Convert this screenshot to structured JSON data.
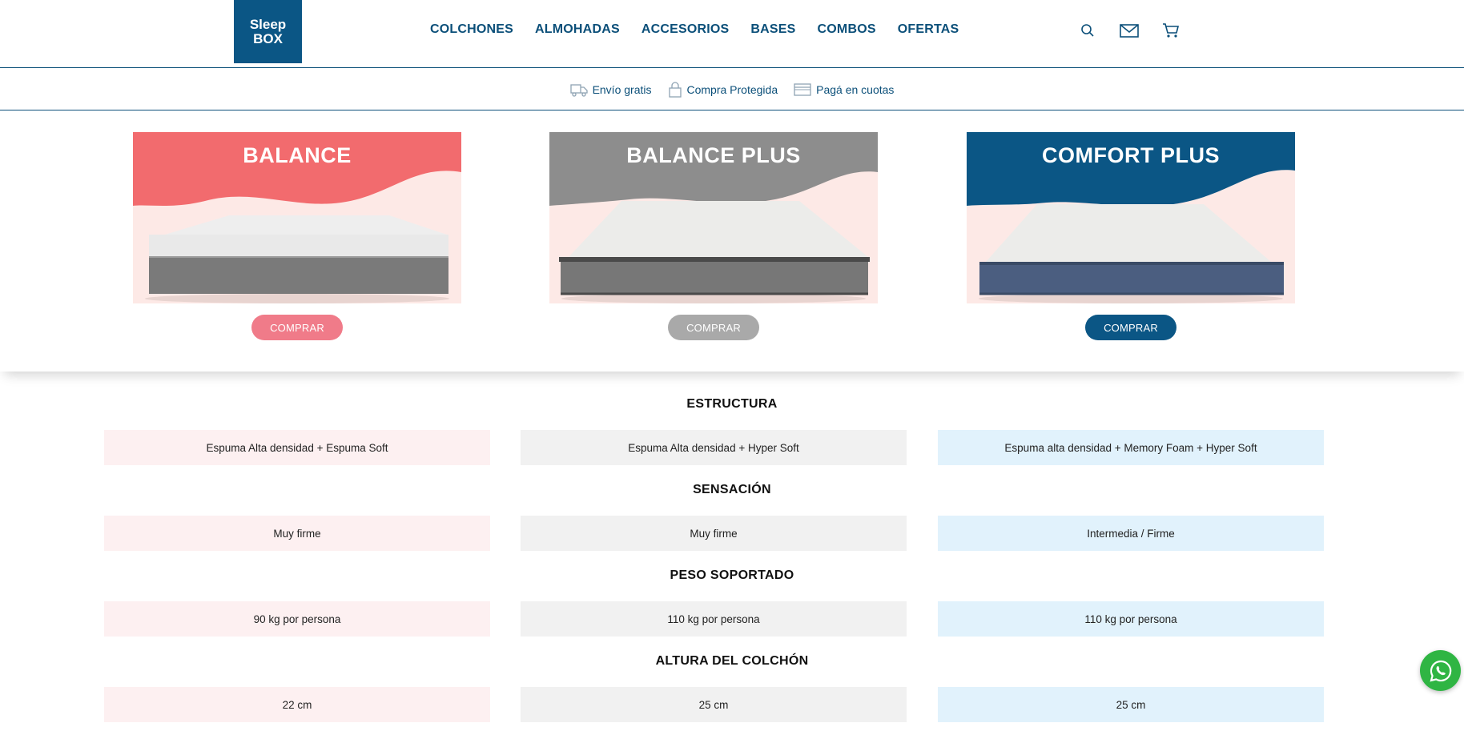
{
  "brand": {
    "line1": "Sleep",
    "line2": "BOX",
    "color": "#0b5685"
  },
  "nav": [
    "COLCHONES",
    "ALMOHADAS",
    "ACCESORIOS",
    "BASES",
    "COMBOS",
    "OFERTAS"
  ],
  "header_icons": [
    "search-icon",
    "mail-icon",
    "cart-icon"
  ],
  "benefits": [
    {
      "icon": "truck-icon",
      "label": "Envío gratis"
    },
    {
      "icon": "lock-icon",
      "label": "Compra Protegida"
    },
    {
      "icon": "card-icon",
      "label": "Pagá en cuotas"
    }
  ],
  "products": [
    {
      "name": "BALANCE",
      "button": "COMPRAR",
      "accent": "#f26b6e",
      "button_color": "#f07b89"
    },
    {
      "name": "BALANCE PLUS",
      "button": "COMPRAR",
      "accent": "#8d8d8d",
      "button_color": "#a9a9a9"
    },
    {
      "name": "COMFORT PLUS",
      "button": "COMPRAR",
      "accent": "#0b5685",
      "button_color": "#0b5685"
    }
  ],
  "specs": [
    {
      "title": "ESTRUCTURA",
      "values": [
        "Espuma Alta densidad + Espuma Soft",
        "Espuma Alta densidad + Hyper Soft",
        "Espuma alta densidad + Memory Foam + Hyper Soft"
      ]
    },
    {
      "title": "SENSACIÓN",
      "values": [
        "Muy firme",
        "Muy firme",
        "Intermedia / Firme"
      ]
    },
    {
      "title": "PESO SOPORTADO",
      "values": [
        "90 kg por persona",
        "110 kg por persona",
        "110 kg por persona"
      ]
    },
    {
      "title": "ALTURA DEL COLCHÓN",
      "values": [
        "22 cm",
        "25 cm",
        "25 cm"
      ]
    }
  ],
  "whatsapp_icon": "whatsapp-icon"
}
